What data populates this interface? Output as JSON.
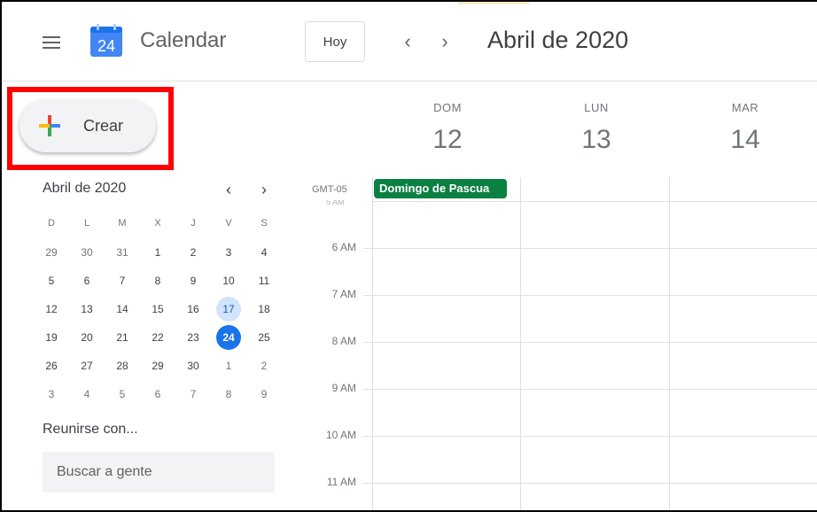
{
  "header": {
    "app_title": "Calendar",
    "logo_day": "24",
    "today_label": "Hoy",
    "prev_icon": "‹",
    "next_icon": "›",
    "current_range": "Abril de 2020"
  },
  "create_button": {
    "label": "Crear"
  },
  "mini_calendar": {
    "title": "Abril de 2020",
    "prev_icon": "‹",
    "next_icon": "›",
    "weekdays": [
      "D",
      "L",
      "M",
      "X",
      "J",
      "V",
      "S"
    ],
    "weeks": [
      [
        {
          "d": "29",
          "dim": true
        },
        {
          "d": "30",
          "dim": true
        },
        {
          "d": "31",
          "dim": true
        },
        {
          "d": "1"
        },
        {
          "d": "2"
        },
        {
          "d": "3"
        },
        {
          "d": "4"
        }
      ],
      [
        {
          "d": "5"
        },
        {
          "d": "6"
        },
        {
          "d": "7"
        },
        {
          "d": "8"
        },
        {
          "d": "9"
        },
        {
          "d": "10"
        },
        {
          "d": "11"
        }
      ],
      [
        {
          "d": "12"
        },
        {
          "d": "13"
        },
        {
          "d": "14"
        },
        {
          "d": "15"
        },
        {
          "d": "16"
        },
        {
          "d": "17",
          "sel": true
        },
        {
          "d": "18"
        }
      ],
      [
        {
          "d": "19"
        },
        {
          "d": "20"
        },
        {
          "d": "21"
        },
        {
          "d": "22"
        },
        {
          "d": "23"
        },
        {
          "d": "24",
          "today": true
        },
        {
          "d": "25"
        }
      ],
      [
        {
          "d": "26"
        },
        {
          "d": "27"
        },
        {
          "d": "28"
        },
        {
          "d": "29"
        },
        {
          "d": "30"
        },
        {
          "d": "1",
          "dim": true
        },
        {
          "d": "2",
          "dim": true
        }
      ],
      [
        {
          "d": "3",
          "dim": true
        },
        {
          "d": "4",
          "dim": true
        },
        {
          "d": "5",
          "dim": true
        },
        {
          "d": "6",
          "dim": true
        },
        {
          "d": "7",
          "dim": true
        },
        {
          "d": "8",
          "dim": true
        },
        {
          "d": "9",
          "dim": true
        }
      ]
    ]
  },
  "meet": {
    "title": "Reunirse con...",
    "search_placeholder": "Buscar a gente"
  },
  "week_view": {
    "timezone": "GMT-05",
    "days": [
      {
        "dow": "DOM",
        "num": "12"
      },
      {
        "dow": "LUN",
        "num": "13"
      },
      {
        "dow": "MAR",
        "num": "14"
      }
    ],
    "all_day_event": "Domingo de Pascua",
    "cut_off_label": "5 AM",
    "hours": [
      "6 AM",
      "7 AM",
      "8 AM",
      "9 AM",
      "10 AM",
      "11 AM"
    ]
  },
  "colors": {
    "event": "#0b8043",
    "today": "#1a73e8",
    "selected": "#d2e3fc",
    "highlight": "#ff0000"
  }
}
